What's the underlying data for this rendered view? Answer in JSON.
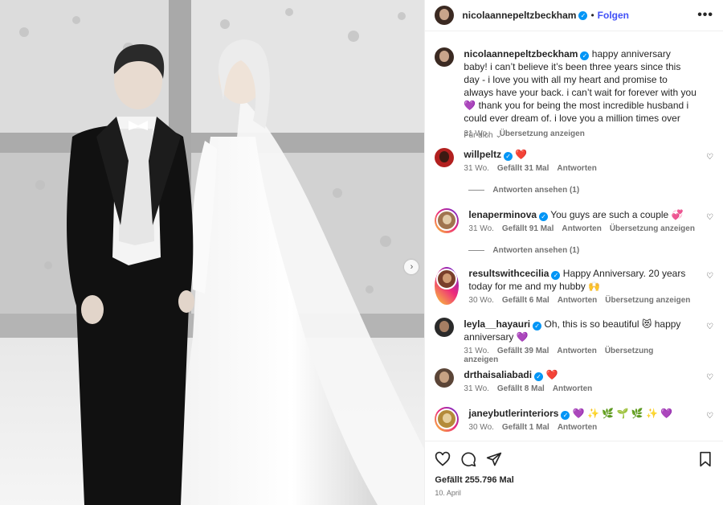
{
  "header": {
    "username": "nicolaannepeltzbeckham",
    "follow_label": "Folgen",
    "more_label": "•••"
  },
  "caption": {
    "username": "nicolaannepeltzbeckham",
    "text": "happy anniversary baby! i can’t believe it’s been three years since this day - i love you with all my heart and promise to always have your back. i can’t wait for forever with you 💜 thank you for being the most incredible husband i could ever dream of. i love you a million times over",
    "time": "31 Wo.",
    "translate": "Übersetzung anzeigen"
  },
  "filter_label": "Für dich",
  "comments": [
    {
      "username": "willpeltz",
      "text": "❤️",
      "time": "31 Wo.",
      "likes": "Gefällt 31 Mal",
      "reply": "Antworten",
      "translate": "",
      "replies": "Antworten ansehen (1)"
    },
    {
      "username": "lenaperminova",
      "text": "You guys are such a couple 💞",
      "time": "31 Wo.",
      "likes": "Gefällt 91 Mal",
      "reply": "Antworten",
      "translate": "Übersetzung anzeigen",
      "replies": "Antworten ansehen (1)"
    },
    {
      "username": "resultswithcecilia",
      "text": "Happy Anniversary. 20 years today for me and my hubby 🙌",
      "time": "30 Wo.",
      "likes": "Gefällt 6 Mal",
      "reply": "Antworten",
      "translate": "Übersetzung anzeigen",
      "replies": ""
    },
    {
      "username": "leyla__hayauri",
      "text": "Oh, this is so beautiful 😻 happy anniversary 💜",
      "time": "31 Wo.",
      "likes": "Gefällt 39 Mal",
      "reply": "Antworten",
      "translate": "Übersetzung anzeigen",
      "replies": ""
    },
    {
      "username": "drthaisaliabadi",
      "text": "❤️",
      "time": "31 Wo.",
      "likes": "Gefällt 8 Mal",
      "reply": "Antworten",
      "translate": "",
      "replies": ""
    },
    {
      "username": "janeybutlerinteriors",
      "text": "💜 ✨ 🌿 🌱 🌿 ✨ 💜",
      "time": "30 Wo.",
      "likes": "Gefällt 1 Mal",
      "reply": "Antworten",
      "translate": "",
      "replies": ""
    }
  ],
  "footer": {
    "likes": "Gefällt 255.796 Mal",
    "date": "10. April"
  }
}
